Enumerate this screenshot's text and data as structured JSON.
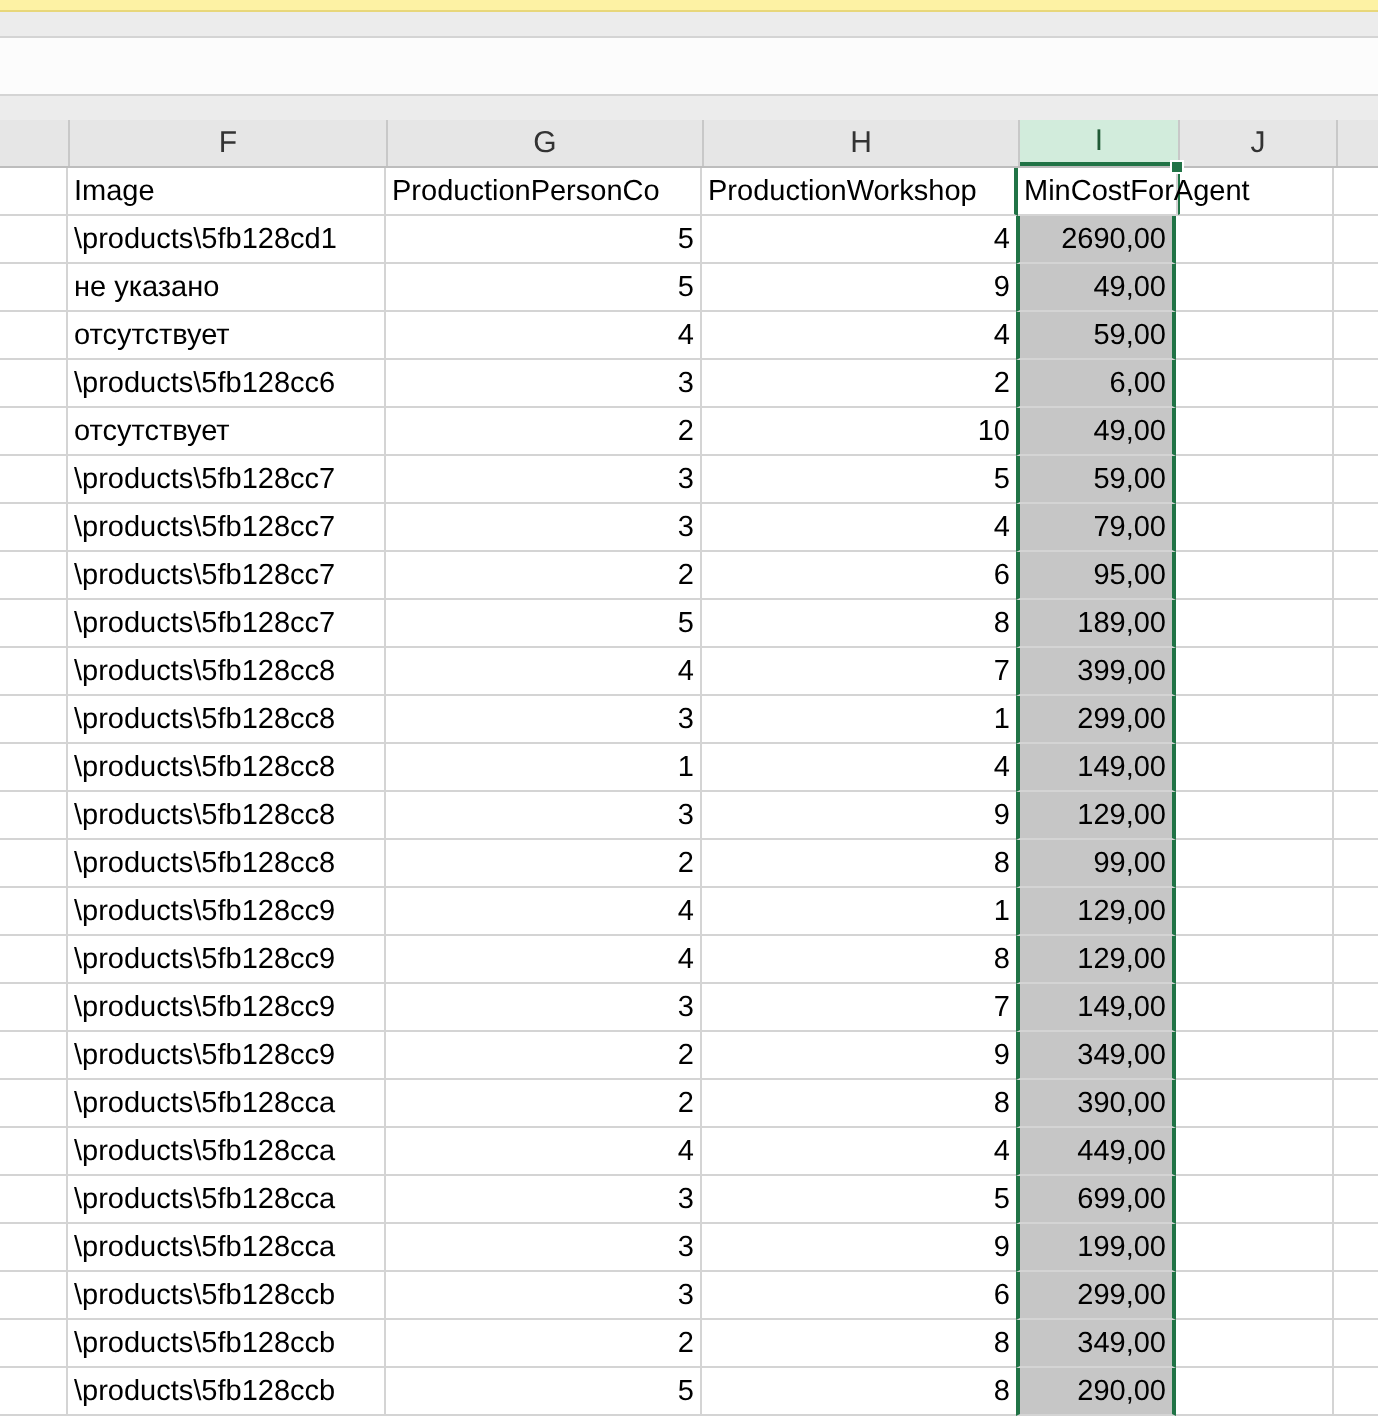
{
  "columns": [
    {
      "label": "F",
      "selected": false
    },
    {
      "label": "G",
      "selected": false
    },
    {
      "label": "H",
      "selected": false
    },
    {
      "label": "I",
      "selected": true
    },
    {
      "label": "J",
      "selected": false
    }
  ],
  "header_row": [
    "Image",
    "ProductionPersonCo",
    "ProductionWorkshop",
    "MinCostForAgent"
  ],
  "rows": [
    [
      "\\products\\5fb128cd1",
      "5",
      "4",
      "2690,00"
    ],
    [
      "не указано",
      "5",
      "9",
      "49,00"
    ],
    [
      "отсутствует",
      "4",
      "4",
      "59,00"
    ],
    [
      "\\products\\5fb128cc6",
      "3",
      "2",
      "6,00"
    ],
    [
      "отсутствует",
      "2",
      "10",
      "49,00"
    ],
    [
      "\\products\\5fb128cc7",
      "3",
      "5",
      "59,00"
    ],
    [
      "\\products\\5fb128cc7",
      "3",
      "4",
      "79,00"
    ],
    [
      "\\products\\5fb128cc7",
      "2",
      "6",
      "95,00"
    ],
    [
      "\\products\\5fb128cc7",
      "5",
      "8",
      "189,00"
    ],
    [
      "\\products\\5fb128cc8",
      "4",
      "7",
      "399,00"
    ],
    [
      "\\products\\5fb128cc8",
      "3",
      "1",
      "299,00"
    ],
    [
      "\\products\\5fb128cc8",
      "1",
      "4",
      "149,00"
    ],
    [
      "\\products\\5fb128cc8",
      "3",
      "9",
      "129,00"
    ],
    [
      "\\products\\5fb128cc8",
      "2",
      "8",
      "99,00"
    ],
    [
      "\\products\\5fb128cc9",
      "4",
      "1",
      "129,00"
    ],
    [
      "\\products\\5fb128cc9",
      "4",
      "8",
      "129,00"
    ],
    [
      "\\products\\5fb128cc9",
      "3",
      "7",
      "149,00"
    ],
    [
      "\\products\\5fb128cc9",
      "2",
      "9",
      "349,00"
    ],
    [
      "\\products\\5fb128cca",
      "2",
      "8",
      "390,00"
    ],
    [
      "\\products\\5fb128cca",
      "4",
      "4",
      "449,00"
    ],
    [
      "\\products\\5fb128cca",
      "3",
      "5",
      "699,00"
    ],
    [
      "\\products\\5fb128cca",
      "3",
      "9",
      "199,00"
    ],
    [
      "\\products\\5fb128ccb",
      "3",
      "6",
      "299,00"
    ],
    [
      "\\products\\5fb128ccb",
      "2",
      "8",
      "349,00"
    ],
    [
      "\\products\\5fb128ccb",
      "5",
      "8",
      "290,00"
    ]
  ]
}
